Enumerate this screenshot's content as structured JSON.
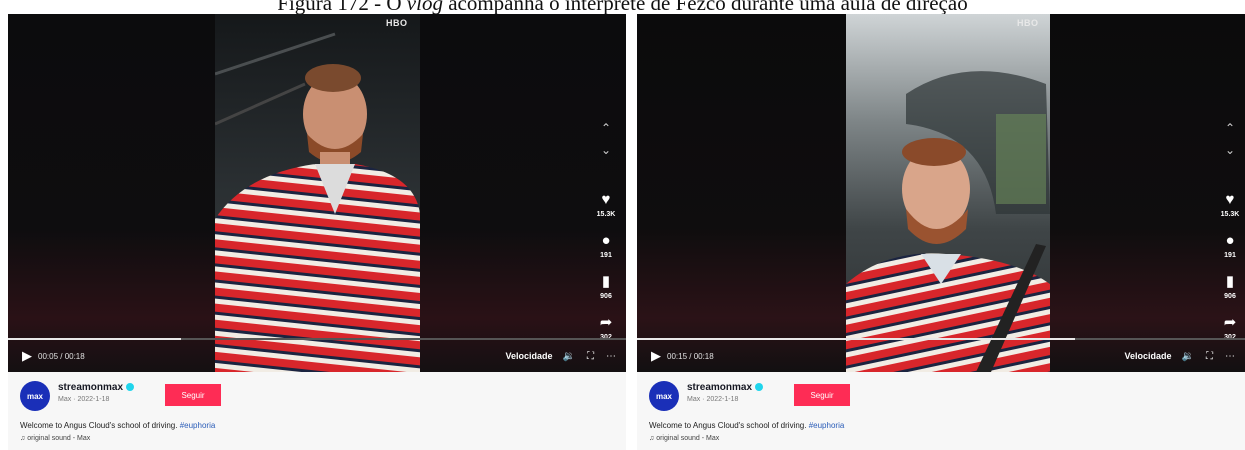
{
  "caption": {
    "prefix": "Figura 172 - O ",
    "italic": "vlog",
    "suffix": " acompanha o intérprete de Fezco durante uma aula de direção"
  },
  "panels": [
    {
      "brand": "HBO",
      "likes": "15.3K",
      "comments": "191",
      "saves": "906",
      "shares": "302",
      "time": "00:05 / 00:18",
      "progress": 0.28,
      "speed_label": "Velocidade",
      "username": "streamonmax",
      "avatar_text": "max",
      "meta": "Max · 2022-1-18",
      "follow_label": "Seguir",
      "description": "Welcome to Angus Cloud's school of driving.",
      "hashtag": "#euphoria",
      "sound": "original sound - Max"
    },
    {
      "brand": "HBO",
      "likes": "15.3K",
      "comments": "191",
      "saves": "906",
      "shares": "302",
      "time": "00:15 / 00:18",
      "progress": 0.72,
      "speed_label": "Velocidade",
      "username": "streamonmax",
      "avatar_text": "max",
      "meta": "Max · 2022-1-18",
      "follow_label": "Seguir",
      "description": "Welcome to Angus Cloud's school of driving.",
      "hashtag": "#euphoria",
      "sound": "original sound - Max"
    }
  ],
  "colors": {
    "follow": "#fe2c55",
    "avatar": "#1a2fb8",
    "hashtag": "#2b5db8",
    "verified": "#20d5ec"
  },
  "icons": [
    "chevron-up-icon",
    "chevron-down-icon",
    "heart-icon",
    "comment-icon",
    "bookmark-icon",
    "share-icon",
    "play-icon",
    "volume-icon",
    "fullscreen-icon",
    "more-icon",
    "music-note-icon"
  ]
}
